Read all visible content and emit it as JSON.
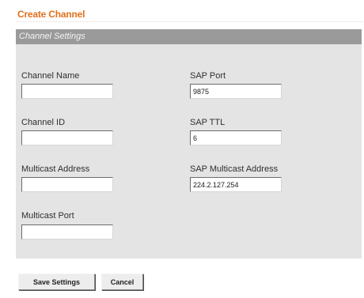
{
  "page": {
    "title": "Create Channel"
  },
  "panel": {
    "header": "Channel Settings"
  },
  "fields": {
    "channel_name": {
      "label": "Channel Name",
      "value": ""
    },
    "channel_id": {
      "label": "Channel ID",
      "value": ""
    },
    "multicast_address": {
      "label": "Multicast Address",
      "value": ""
    },
    "multicast_port": {
      "label": "Multicast Port",
      "value": ""
    },
    "sap_port": {
      "label": "SAP Port",
      "value": "9875"
    },
    "sap_ttl": {
      "label": "SAP TTL",
      "value": "6"
    },
    "sap_multicast_address": {
      "label": "SAP Multicast Address",
      "value": "224.2.127.254"
    }
  },
  "buttons": {
    "save": "Save Settings",
    "cancel": "Cancel"
  },
  "colors": {
    "title": "#e0701c",
    "panel_bg": "#e4e4e4",
    "header_bg": "#9a9a9a"
  }
}
